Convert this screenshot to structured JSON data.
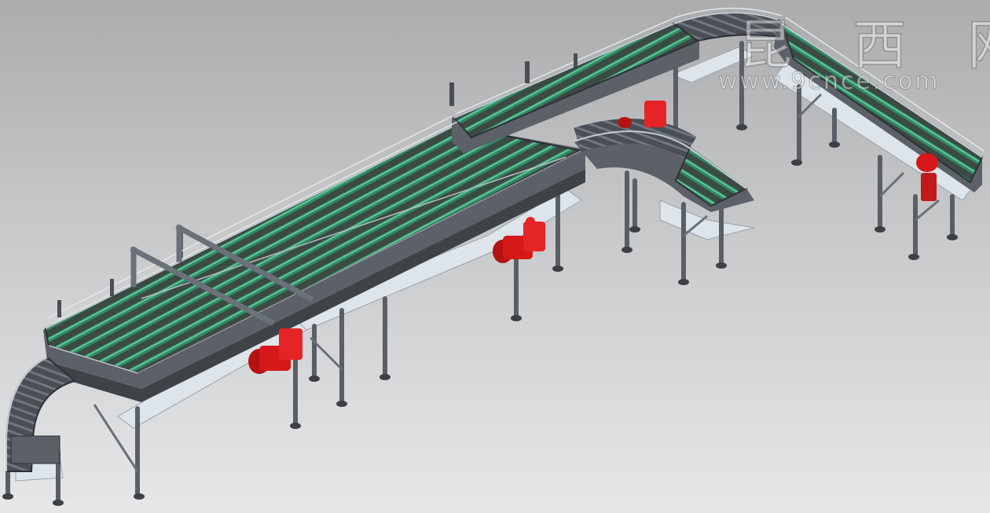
{
  "watermark": {
    "chinese": "昆 西 网",
    "url": "www.9cnce.com"
  },
  "colors": {
    "background_top": "#aaacae",
    "background_bottom": "#e6e7e8",
    "frame": "#5c6168",
    "frame_light": "#8e949b",
    "roller_green": "#2f8a63",
    "roller_light": "#64c59a",
    "motor_red": "#d61818",
    "base_plate": "#dde4ea",
    "leg": "#5a5f66"
  },
  "components": {
    "conveyor_segments": [
      "main-conveyor",
      "upper-conveyor",
      "t-branch-conveyor",
      "right-conveyor",
      "left-curve-conveyor"
    ],
    "drive_motors": 5,
    "support_legs": 24
  }
}
